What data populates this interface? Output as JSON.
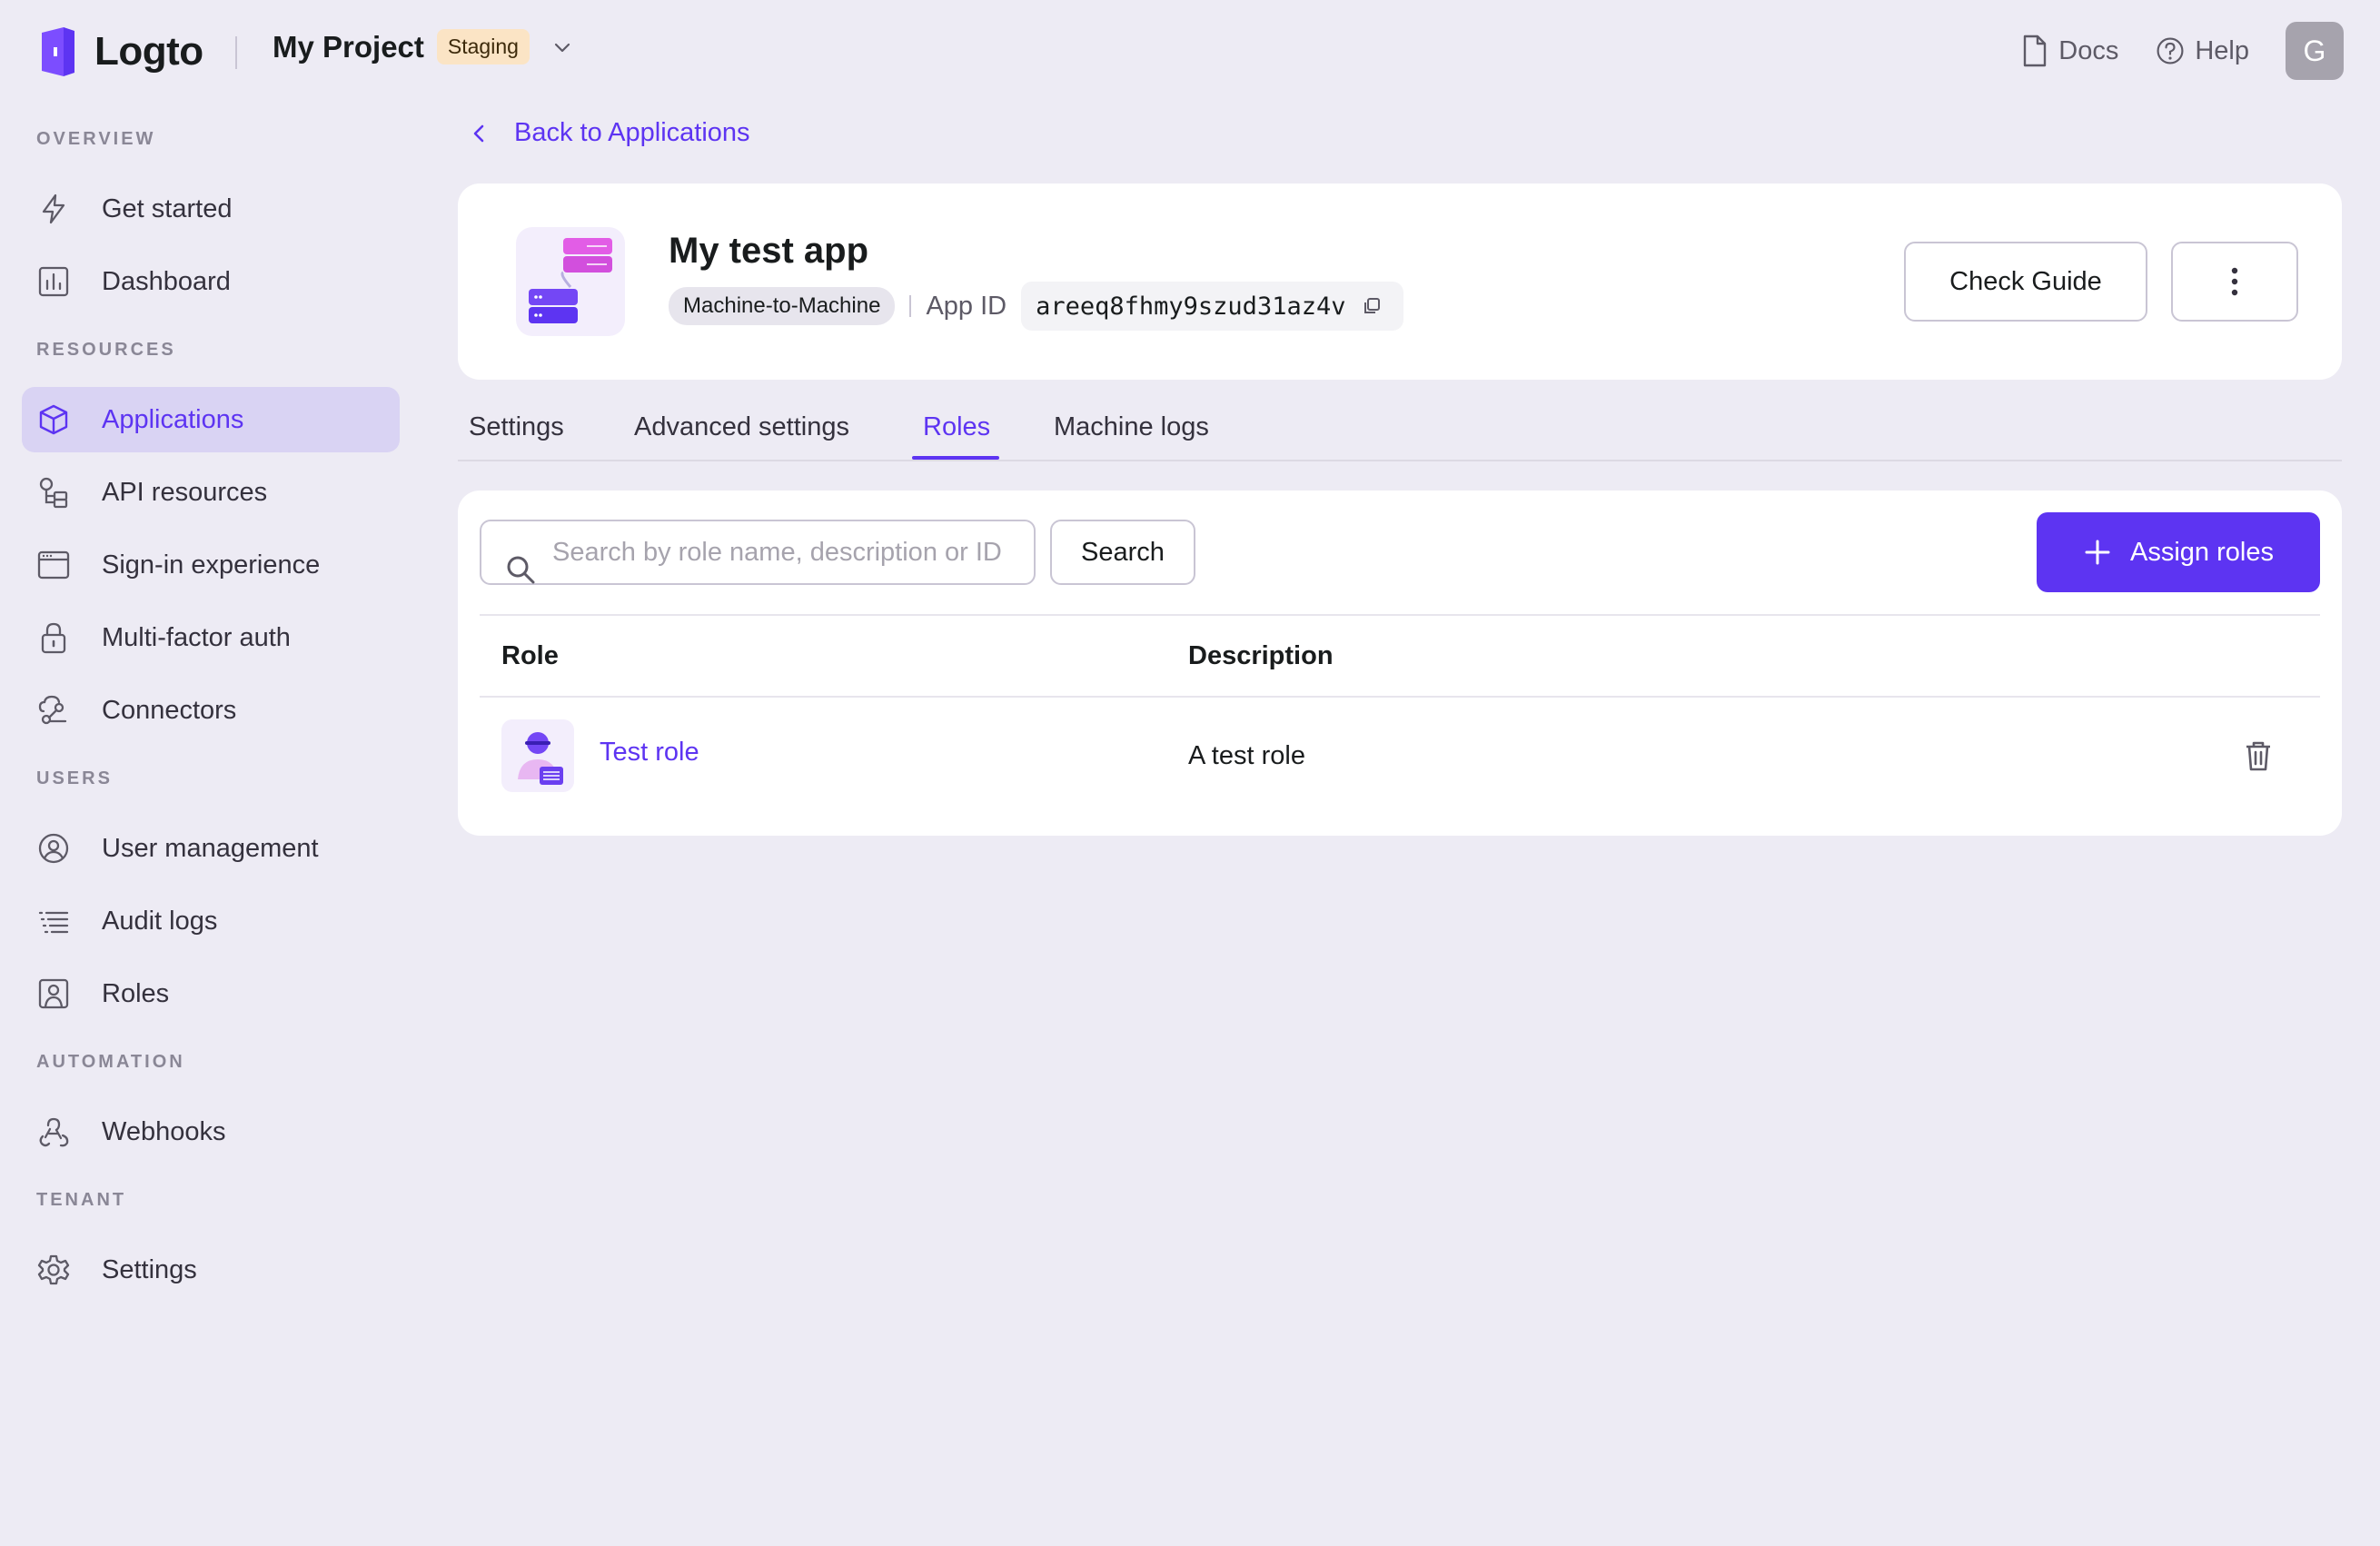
{
  "header": {
    "logo_text": "Logto",
    "project_name": "My Project",
    "env_badge": "Staging",
    "docs_label": "Docs",
    "help_label": "Help",
    "avatar_initial": "G"
  },
  "sidebar": {
    "sections": [
      {
        "title": "OVERVIEW",
        "items": [
          {
            "label": "Get started",
            "icon": "lightning-icon"
          },
          {
            "label": "Dashboard",
            "icon": "chart-icon"
          }
        ]
      },
      {
        "title": "RESOURCES",
        "items": [
          {
            "label": "Applications",
            "icon": "cube-icon",
            "active": true
          },
          {
            "label": "API resources",
            "icon": "api-icon"
          },
          {
            "label": "Sign-in experience",
            "icon": "browser-icon"
          },
          {
            "label": "Multi-factor auth",
            "icon": "lock-icon"
          },
          {
            "label": "Connectors",
            "icon": "connector-icon"
          }
        ]
      },
      {
        "title": "USERS",
        "items": [
          {
            "label": "User management",
            "icon": "user-circle-icon"
          },
          {
            "label": "Audit logs",
            "icon": "list-icon"
          },
          {
            "label": "Roles",
            "icon": "role-icon"
          }
        ]
      },
      {
        "title": "AUTOMATION",
        "items": [
          {
            "label": "Webhooks",
            "icon": "webhook-icon"
          }
        ]
      },
      {
        "title": "TENANT",
        "items": [
          {
            "label": "Settings",
            "icon": "gear-icon"
          }
        ]
      }
    ]
  },
  "main": {
    "back_label": "Back to Applications",
    "app": {
      "name": "My test app",
      "type": "Machine-to-Machine",
      "app_id_label": "App ID",
      "app_id": "areeq8fhmy9szud31az4v",
      "check_guide_label": "Check Guide"
    },
    "tabs": [
      {
        "label": "Settings"
      },
      {
        "label": "Advanced settings"
      },
      {
        "label": "Roles",
        "active": true
      },
      {
        "label": "Machine logs"
      }
    ],
    "roles": {
      "search_placeholder": "Search by role name, description or ID",
      "search_button": "Search",
      "assign_button": "Assign roles",
      "columns": [
        "Role",
        "Description"
      ],
      "rows": [
        {
          "name": "Test role",
          "description": "A test role"
        }
      ]
    }
  },
  "colors": {
    "primary": "#5d34f2",
    "background": "#edebf4",
    "sidebar_active": "#d9d3f3",
    "env_badge": "#fbe4c5"
  }
}
